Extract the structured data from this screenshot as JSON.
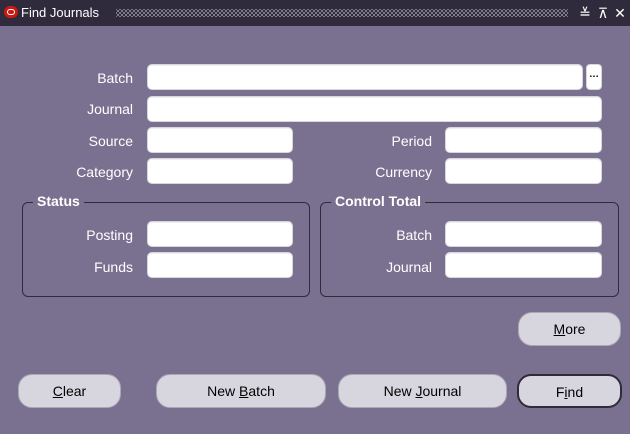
{
  "window": {
    "title": "Find Journals",
    "controls": {
      "minimize": "≚",
      "maximize": "⊼",
      "close": "✕"
    }
  },
  "fields": {
    "batch": {
      "label": "Batch",
      "value": "",
      "lov_glyph": "…"
    },
    "journal": {
      "label": "Journal",
      "value": ""
    },
    "source": {
      "label": "Source",
      "value": ""
    },
    "period": {
      "label": "Period",
      "value": ""
    },
    "category": {
      "label": "Category",
      "value": ""
    },
    "currency": {
      "label": "Currency",
      "value": ""
    }
  },
  "status_group": {
    "title": "Status",
    "posting": {
      "label": "Posting",
      "value": ""
    },
    "funds": {
      "label": "Funds",
      "value": ""
    }
  },
  "control_total_group": {
    "title": "Control Total",
    "batch": {
      "label": "Batch",
      "value": ""
    },
    "journal": {
      "label": "Journal",
      "value": ""
    }
  },
  "buttons": {
    "more": {
      "pre": "",
      "mnemonic": "M",
      "post": "ore"
    },
    "clear": {
      "pre": "",
      "mnemonic": "C",
      "post": "lear"
    },
    "new_batch": {
      "pre": "New ",
      "mnemonic": "B",
      "post": "atch"
    },
    "new_journal": {
      "pre": "New ",
      "mnemonic": "J",
      "post": "ournal"
    },
    "find": {
      "pre": "F",
      "mnemonic": "i",
      "post": "nd"
    }
  },
  "colors": {
    "window_bg": "#7a7191",
    "titlebar_bg": "#2f2b3c",
    "title_icon": "#c81a12"
  }
}
